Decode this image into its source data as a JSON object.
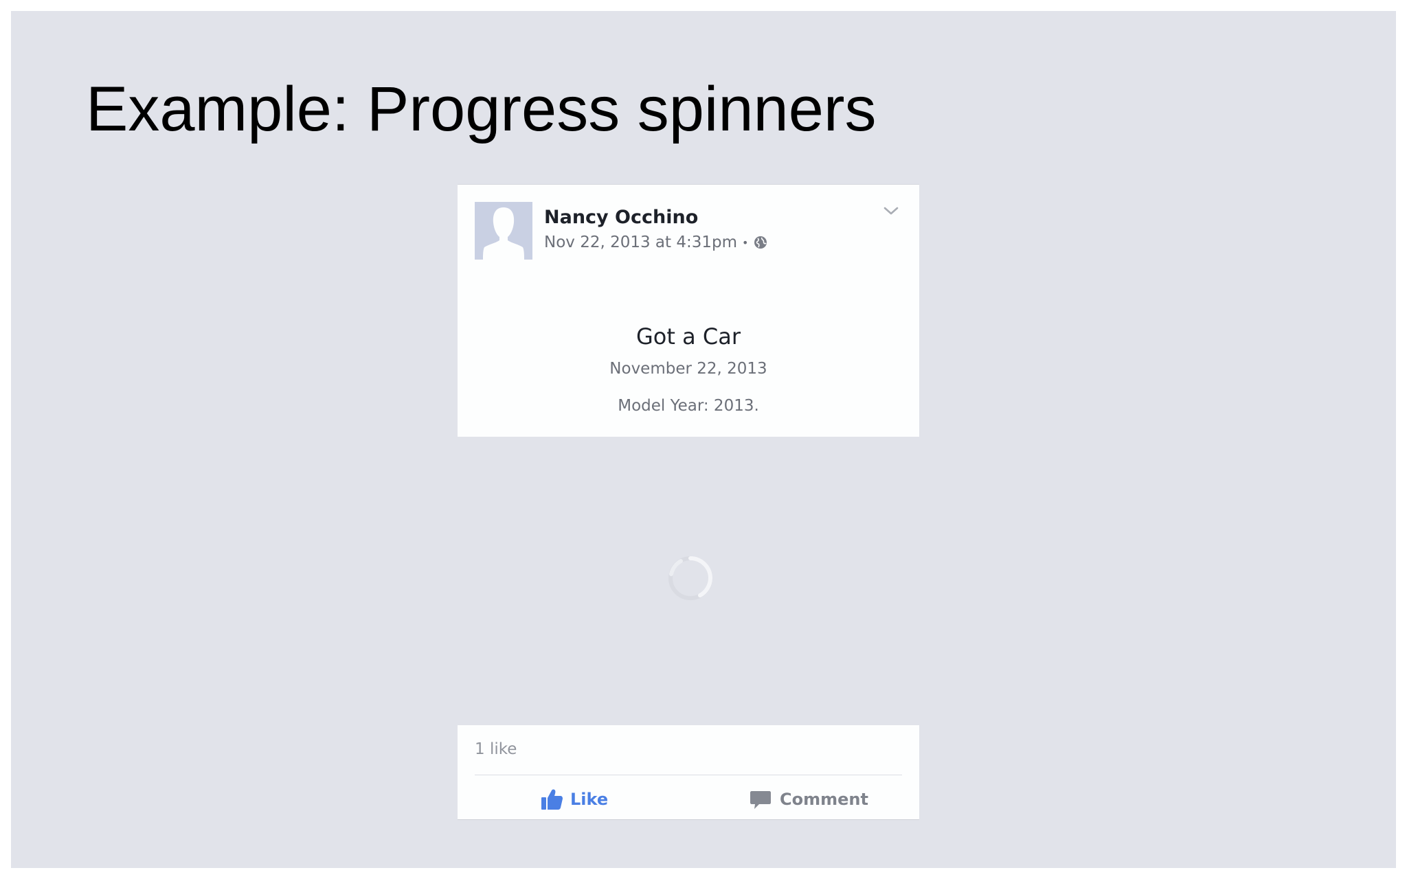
{
  "slide": {
    "title": "Example: Progress spinners"
  },
  "post": {
    "author": "Nancy Occhino",
    "timestamp": "Nov 22, 2013 at 4:31pm",
    "separator": "•",
    "event_title": "Got a Car",
    "event_date": "November 22, 2013",
    "event_detail": "Model Year: 2013."
  },
  "actions": {
    "like_count": "1 like",
    "like_label": "Like",
    "comment_label": "Comment"
  },
  "icons": {
    "avatar": "default-profile-silhouette",
    "privacy": "globe-icon",
    "menu": "chevron-down-icon",
    "spinner": "progress-spinner",
    "like": "thumbs-up-icon",
    "comment": "speech-bubble-icon"
  },
  "colors": {
    "slide_background": "#e1e3ea",
    "card_background": "#fdfefe",
    "like_blue": "#4a7fe4",
    "muted_text": "#6b6f78",
    "avatar_placeholder": "#c9d0e3"
  }
}
